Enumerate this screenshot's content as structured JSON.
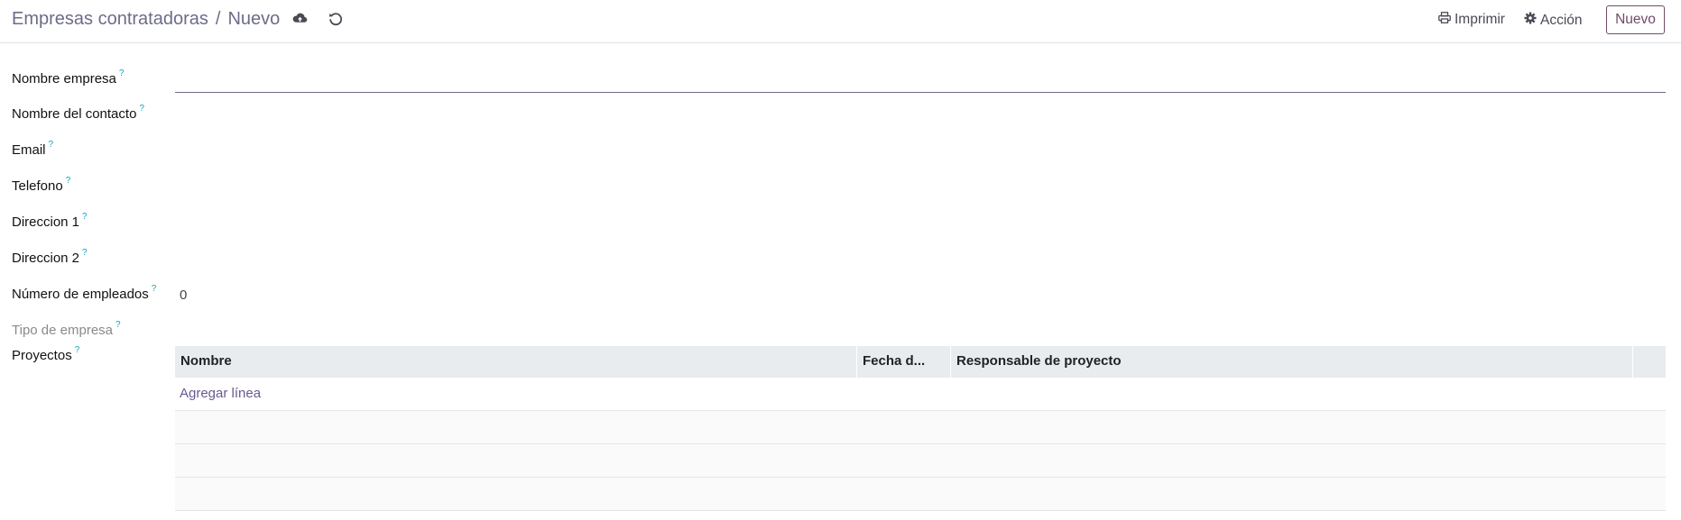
{
  "header": {
    "breadcrumb_parent": "Empresas contratadoras",
    "breadcrumb_separator": "/",
    "breadcrumb_current": "Nuevo",
    "print_label": "Imprimir",
    "action_label": "Acción",
    "new_label": "Nuevo",
    "save_icon": "cloud-upload-icon",
    "discard_icon": "undo-icon",
    "accent_color": "#714b67"
  },
  "form": {
    "fields": {
      "nombre_empresa": {
        "label": "Nombre empresa",
        "help": "?",
        "value": ""
      },
      "nombre_contacto": {
        "label": "Nombre del contacto",
        "help": "?",
        "value": ""
      },
      "email": {
        "label": "Email",
        "help": "?",
        "value": ""
      },
      "telefono": {
        "label": "Telefono",
        "help": "?",
        "value": ""
      },
      "direccion1": {
        "label": "Direccion 1",
        "help": "?",
        "value": ""
      },
      "direccion2": {
        "label": "Direccion 2",
        "help": "?",
        "value": ""
      },
      "num_empleados": {
        "label": "Número de empleados",
        "help": "?",
        "value": "0"
      },
      "tipo_empresa": {
        "label": "Tipo de empresa",
        "help": "?",
        "value": ""
      },
      "proyectos": {
        "label": "Proyectos",
        "help": "?"
      }
    }
  },
  "projects_table": {
    "columns": [
      "Nombre",
      "Fecha d...",
      "Responsable de proyecto"
    ],
    "add_line_label": "Agregar línea",
    "rows": []
  }
}
